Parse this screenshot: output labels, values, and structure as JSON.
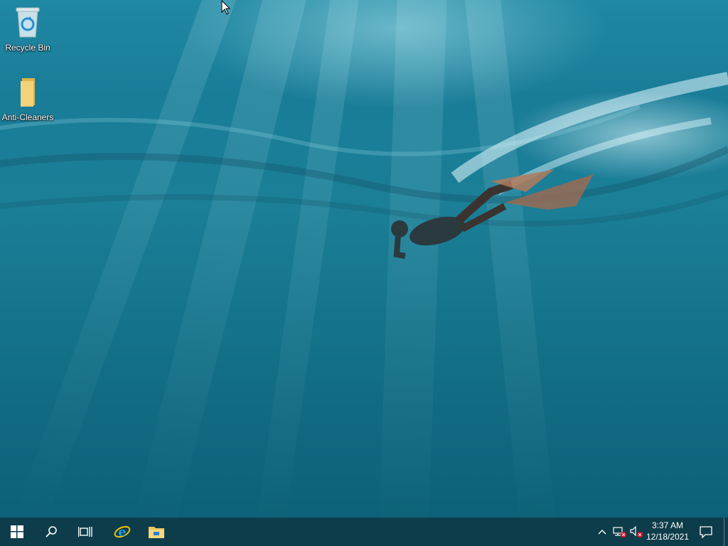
{
  "desktop": {
    "icons": [
      {
        "label": "Recycle Bin",
        "icon": "recycle-bin-icon"
      },
      {
        "label": "Anti-Cleaners",
        "icon": "folder-icon"
      }
    ]
  },
  "taskbar": {
    "pinned": [
      {
        "name": "start-button",
        "icon": "windows-logo-icon"
      },
      {
        "name": "search-button",
        "icon": "search-icon"
      },
      {
        "name": "task-view-button",
        "icon": "task-view-icon"
      },
      {
        "name": "internet-explorer-button",
        "icon": "internet-explorer-icon"
      },
      {
        "name": "file-explorer-button",
        "icon": "file-explorer-icon"
      }
    ],
    "tray": {
      "icons": [
        "chevron-up-icon",
        "network-disconnected-icon",
        "volume-muted-icon"
      ]
    },
    "clock": {
      "time": "3:37 AM",
      "date": "12/18/2021"
    },
    "notifications_icon": "action-center-icon"
  },
  "colors": {
    "taskbar_bg": "#0d3d4a",
    "ie_blue": "#1a9be0",
    "folder_yellow": "#f0c75a"
  }
}
